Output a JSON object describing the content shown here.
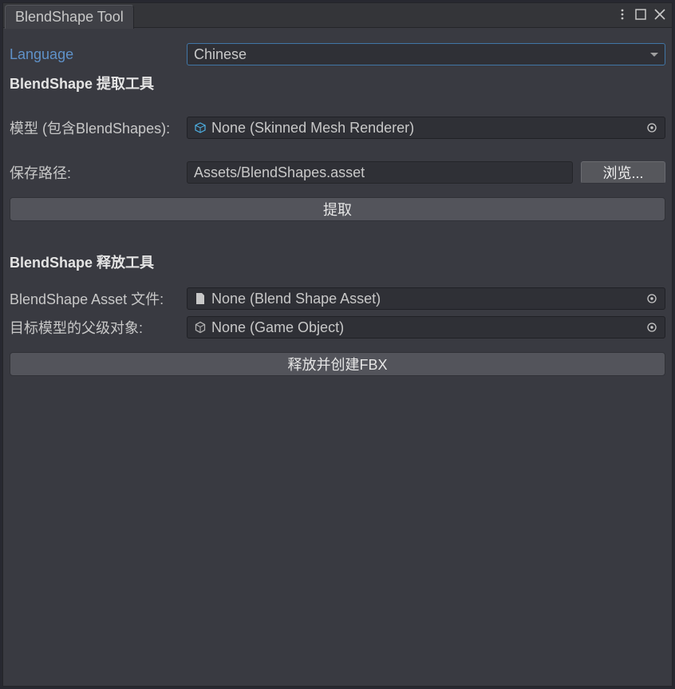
{
  "window": {
    "title": "BlendShape Tool"
  },
  "language": {
    "label": "Language",
    "value": "Chinese"
  },
  "extract": {
    "header": "BlendShape 提取工具",
    "model_label": "模型 (包含BlendShapes):",
    "model_value": "None (Skinned Mesh Renderer)",
    "save_path_label": "保存路径:",
    "save_path_value": "Assets/BlendShapes.asset",
    "browse_label": "浏览...",
    "extract_button": "提取"
  },
  "release": {
    "header": "BlendShape 释放工具",
    "asset_label": "BlendShape Asset 文件:",
    "asset_value": "None (Blend Shape Asset)",
    "target_parent_label": "目标模型的父级对象:",
    "target_parent_value": "None (Game Object)",
    "release_button": "释放并创建FBX"
  }
}
